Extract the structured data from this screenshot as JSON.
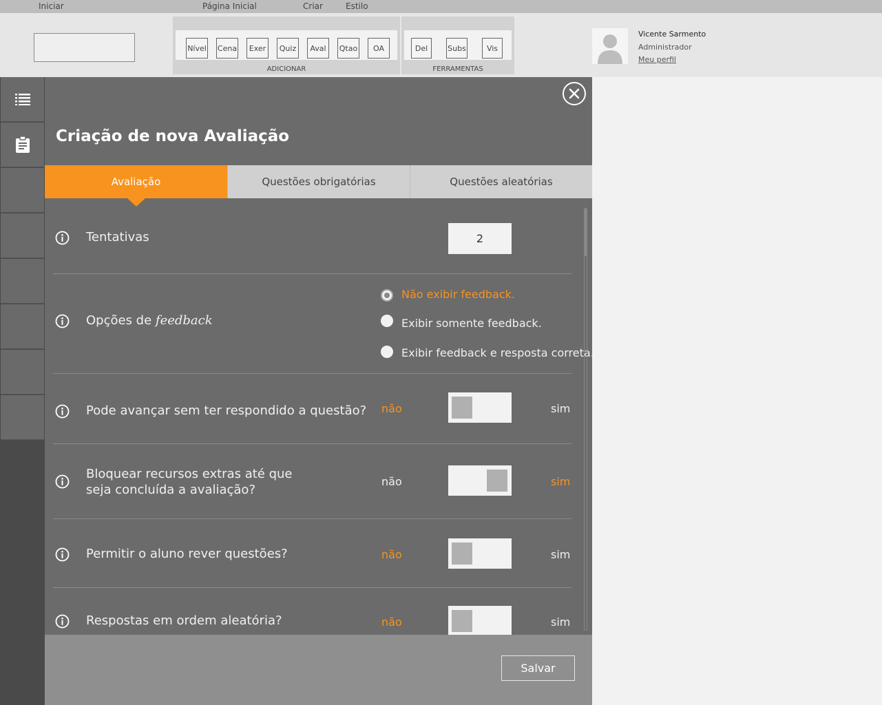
{
  "menu": {
    "items": [
      "Iniciar",
      "Página Inicial",
      "Criar",
      "Estilo"
    ]
  },
  "ribbon": {
    "add_group": {
      "label": "ADICIONAR",
      "buttons": [
        "Nível",
        "Cena",
        "Exer",
        "Quiz",
        "Aval",
        "Qtao",
        "OA"
      ]
    },
    "tools_group": {
      "label": "FERRAMENTAS",
      "buttons": [
        "Del",
        "Subs",
        "Vis"
      ]
    }
  },
  "user": {
    "name": "Vicente Sarmento",
    "role": "Administrador",
    "profile_link": "Meu perfil"
  },
  "sidebar": {
    "icons": [
      "list-icon",
      "clipboard-icon"
    ]
  },
  "modal": {
    "title": "Criação de nova Avaliação",
    "tabs": [
      {
        "label": "Avaliação",
        "active": true
      },
      {
        "label": "Questões obrigatórias",
        "active": false
      },
      {
        "label": "Questões aleatórias",
        "active": false
      }
    ],
    "attempts": {
      "label": "Tentativas",
      "value": "2"
    },
    "feedback": {
      "label_prefix": "Opções de ",
      "label_em": "feedback",
      "options": [
        {
          "label": "Não exibir feedback.",
          "selected": true
        },
        {
          "label": "Exibir somente feedback.",
          "selected": false
        },
        {
          "label": "Exibir feedback e resposta correta.",
          "selected": false
        }
      ]
    },
    "toggles": [
      {
        "label": "Pode avançar sem ter respondido a questão?",
        "no": "não",
        "yes": "sim",
        "value": "não"
      },
      {
        "label": "Bloquear recursos extras até que seja concluída a avaliação?",
        "no": "não",
        "yes": "sim",
        "value": "sim"
      },
      {
        "label": "Permitir o aluno rever questões?",
        "no": "não",
        "yes": "sim",
        "value": "não"
      },
      {
        "label": "Respostas em ordem aleatória?",
        "no": "não",
        "yes": "sim",
        "value": "não"
      }
    ],
    "save_label": "Salvar"
  },
  "colors": {
    "accent": "#f7931e",
    "modal_bg": "#6b6b6b",
    "footer_bg": "#8f8f8f"
  }
}
